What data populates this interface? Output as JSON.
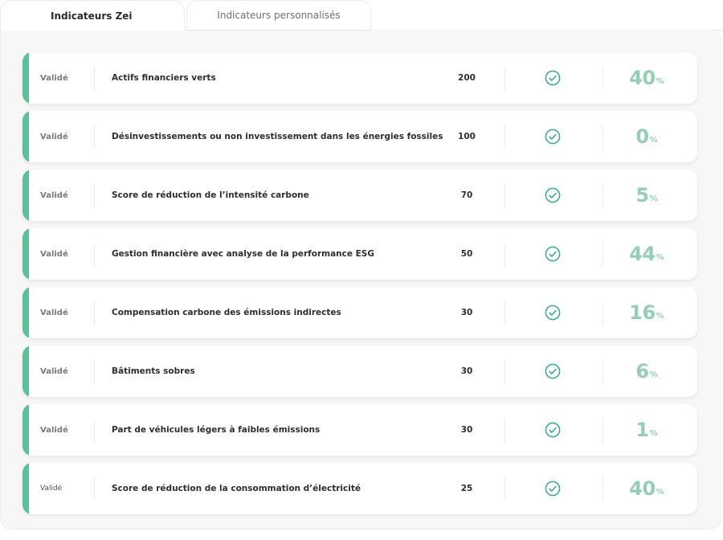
{
  "tabs": [
    {
      "label": "Indicateurs Zei",
      "active": true
    },
    {
      "label": "Indicateurs personnalisés",
      "active": false
    }
  ],
  "colors": {
    "accent": "#5bbf97",
    "percent": "#95cdb6",
    "check": "#3daa85"
  },
  "rows": [
    {
      "status": "Validé",
      "label": "Actifs financiers verts",
      "points": "200",
      "icon": "check-circle-icon",
      "percent": "40",
      "percent_sign": "%"
    },
    {
      "status": "Validé",
      "label": "Désinvestissements ou non investissement dans les énergies fossiles",
      "points": "100",
      "icon": "check-circle-icon",
      "percent": "0",
      "percent_sign": "%"
    },
    {
      "status": "Validé",
      "label": "Score de réduction de l’intensité carbone",
      "points": "70",
      "icon": "check-circle-icon",
      "percent": "5",
      "percent_sign": "%"
    },
    {
      "status": "Validé",
      "label": "Gestion financière avec analyse de la performance ESG",
      "points": "50",
      "icon": "check-circle-icon",
      "percent": "44",
      "percent_sign": "%"
    },
    {
      "status": "Validé",
      "label": "Compensation carbone des émissions indirectes",
      "points": "30",
      "icon": "check-circle-icon",
      "percent": "16",
      "percent_sign": "%"
    },
    {
      "status": "Validé",
      "label": "Bâtiments sobres",
      "points": "30",
      "icon": "check-circle-icon",
      "percent": "6",
      "percent_sign": "%"
    },
    {
      "status": "Validé",
      "label": "Part de véhicules légers à faibles émissions",
      "points": "30",
      "icon": "check-circle-icon",
      "percent": "1",
      "percent_sign": "%"
    },
    {
      "status": "Validé",
      "label": "Score de réduction de la consommation d’électricité",
      "points": "25",
      "icon": "check-circle-icon",
      "percent": "40",
      "percent_sign": "%"
    }
  ]
}
